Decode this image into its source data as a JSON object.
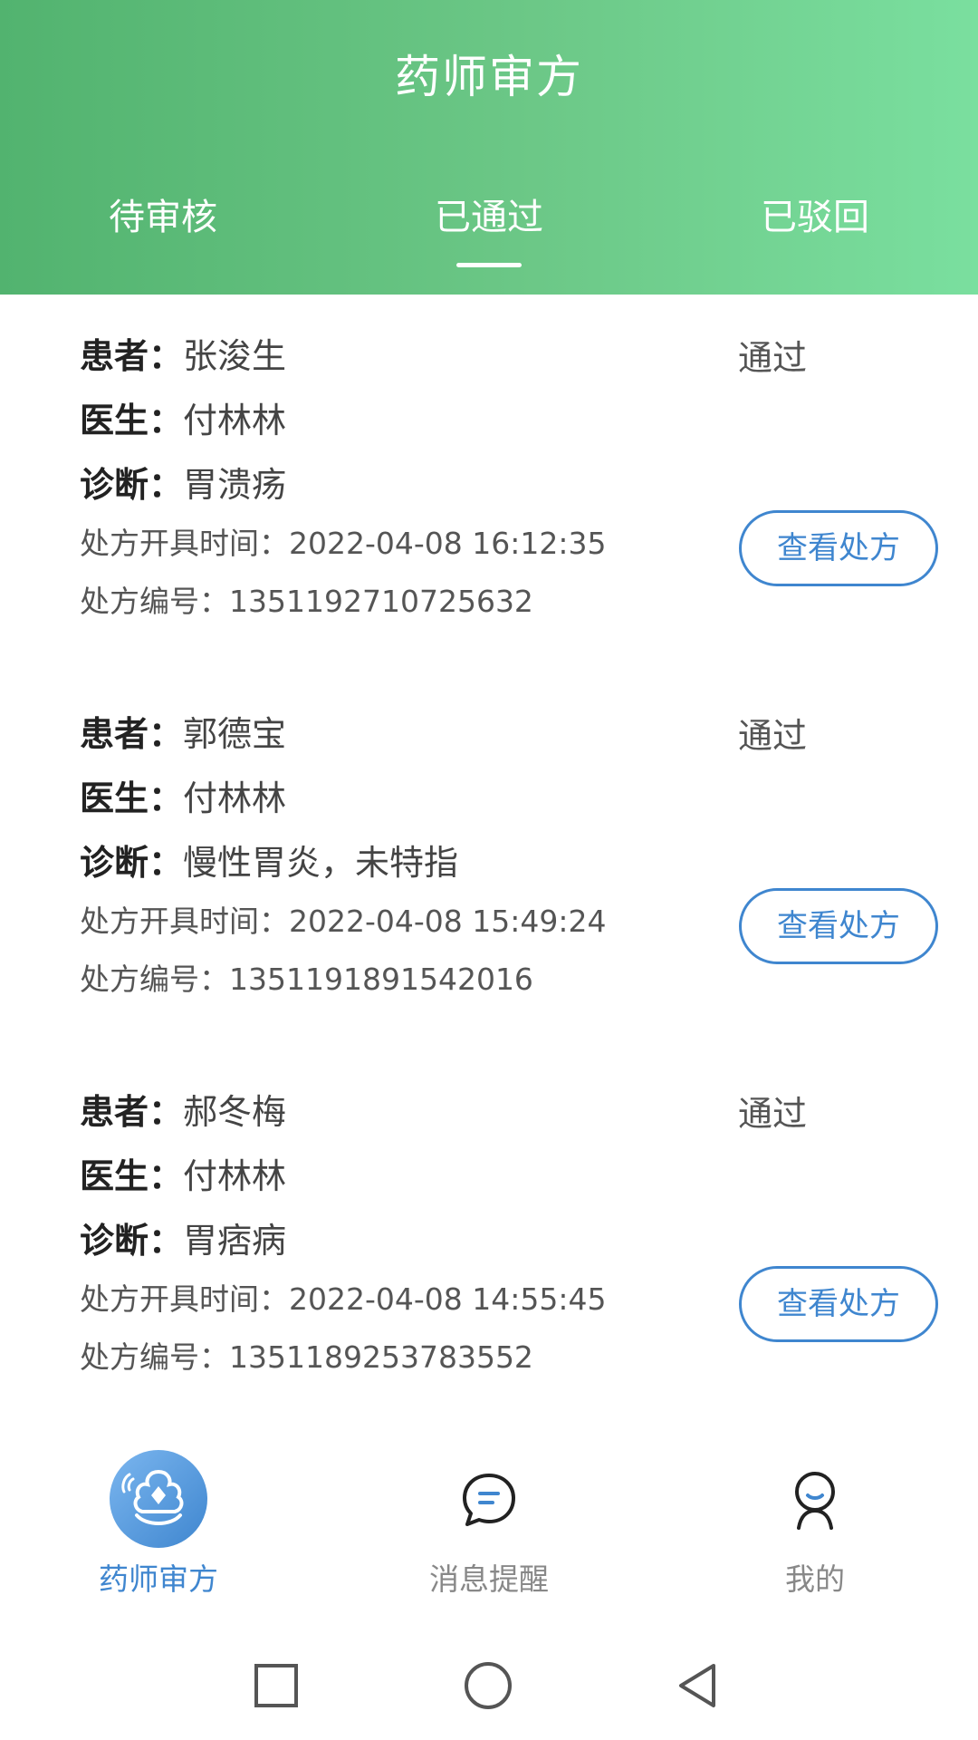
{
  "header": {
    "title": "药师审方",
    "tabs": [
      {
        "label": "待审核"
      },
      {
        "label": "已通过"
      },
      {
        "label": "已驳回"
      }
    ],
    "active_tab": 1
  },
  "labels": {
    "patient": "患者：",
    "doctor": "医生：",
    "diagnosis": "诊断：",
    "time": "处方开具时间：",
    "number": "处方编号："
  },
  "cards": [
    {
      "patient": "张浚生",
      "doctor": "付林林",
      "diagnosis": "胃溃疡",
      "time": "2022-04-08 16:12:35",
      "number": "1351192710725632",
      "status": "通过",
      "button": "查看处方"
    },
    {
      "patient": "郭德宝",
      "doctor": "付林林",
      "diagnosis": "慢性胃炎，未特指",
      "time": "2022-04-08 15:49:24",
      "number": "1351191891542016",
      "status": "通过",
      "button": "查看处方"
    },
    {
      "patient": "郝冬梅",
      "doctor": "付林林",
      "diagnosis": "胃痞病",
      "time": "2022-04-08 14:55:45",
      "number": "1351189253783552",
      "status": "通过",
      "button": "查看处方"
    }
  ],
  "bottom_nav": [
    {
      "label": "药师审方",
      "icon": "pharmacist-logo-icon",
      "active": true
    },
    {
      "label": "消息提醒",
      "icon": "chat-bubble-icon",
      "active": false
    },
    {
      "label": "我的",
      "icon": "person-icon",
      "active": false
    }
  ],
  "colors": {
    "header_start": "#52b36f",
    "header_end": "#7adf9f",
    "accent_blue": "#3f86cf"
  },
  "system_nav": {
    "recent": "square-icon",
    "home": "circle-icon",
    "back": "triangle-back-icon"
  }
}
